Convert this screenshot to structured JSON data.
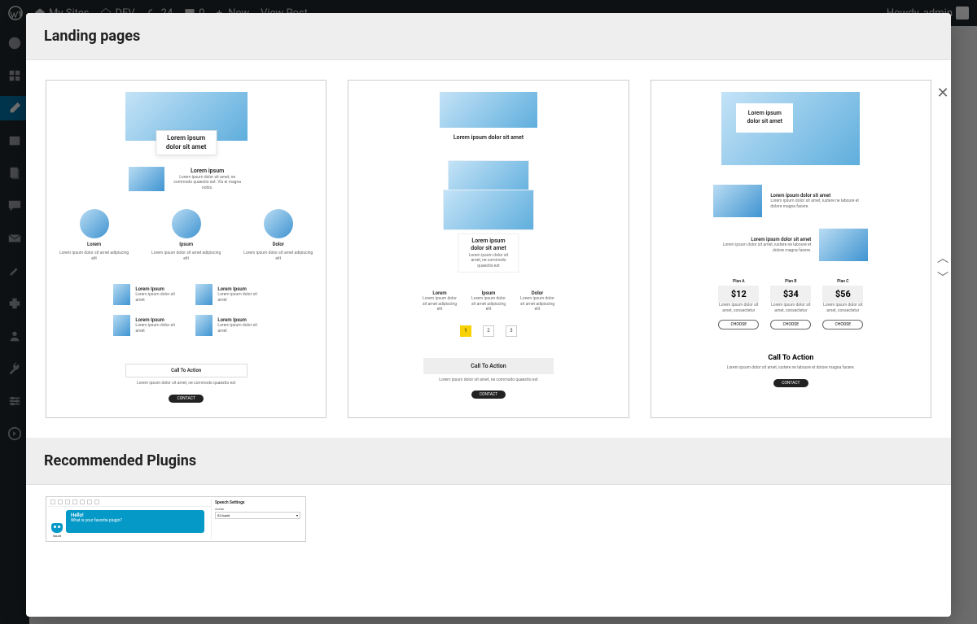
{
  "adminBar": {
    "mySites": "My Sites",
    "siteName": "DEV",
    "updates": "24",
    "comments": "0",
    "newLabel": "New",
    "viewPost": "View Post",
    "howdy": "Howdy, admin"
  },
  "sections": {
    "landing": "Landing pages",
    "plugins": "Recommended Plugins"
  },
  "template1": {
    "heroTitle": "Lorem ipsum dolor sit amet",
    "featureTitle": "Lorem ipsum",
    "featureBody": "Lorem ipsum dolor sit amet, ne commodo quaestio est. Vis ei magna nobis.",
    "col1": "Lorem",
    "col2": "Ipsum",
    "col3": "Dolor",
    "colBody": "Lorem ipsum dolor sit amet adipiscing elit",
    "gridTitle": "Lorem Ipsum",
    "gridBody": "Lorem ipsum dolor sit amet",
    "cta": "Call To Action",
    "ctaBody": "Lorem ipsum dolor sit amet, ne commodo quaestio est",
    "contact": "CONTACT"
  },
  "template2": {
    "heroTitle": "Lorem ipsum dolor sit amet",
    "stackTitle": "Lorem ipsum dolor sit amet",
    "stackBody": "Lorem ipsum dolor sit amet, ne commodo quaestio est",
    "col1": "Lorem",
    "col2": "Ipsum",
    "col3": "Dolor",
    "colBody": "Lorem ipsum dolor sit amet adipiscing elit",
    "page1": "1",
    "page2": "2",
    "page3": "3",
    "cta": "Call To Action",
    "ctaBody": "Lorem ipsum dolor sit amet, ne commodo quaestio est",
    "contact": "CONTACT"
  },
  "template3": {
    "heroTitle": "Lorem ipsum dolor sit amet",
    "featTitle": "Lorem ipsum dolor sit amet",
    "featBody": "Lorem ipsum dolor sit amet, iustere ne laboure et dolore magna facere.",
    "plans": [
      {
        "name": "Plan A",
        "price": "$12"
      },
      {
        "name": "Plan B",
        "price": "$34"
      },
      {
        "name": "Plan C",
        "price": "$56"
      }
    ],
    "planBody": "Lorem ipsum dolor sit amet, consectetur",
    "choose": "CHOOSE",
    "cta": "Call To Action",
    "ctaBody": "Lorem ipsum dolor sit amet, iustere ne laboure et dolore magna facere.",
    "contact": "CONTACT"
  },
  "plugin": {
    "bubbleTitle": "Hello!",
    "bubbleText": "What is your favorite plugin?",
    "avatarLabel": "liquid",
    "panelTitle": "Speech Settings",
    "fieldLabel": "Avatar",
    "fieldValue": "02.liquid"
  }
}
